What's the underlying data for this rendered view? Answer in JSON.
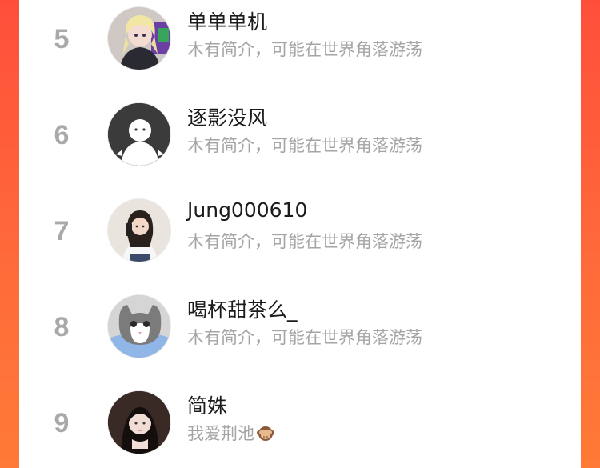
{
  "rankings": [
    {
      "rank": "5",
      "name": "单单单机",
      "bio": "木有简介，可能在世界角落游荡",
      "avatar": "anime-girl-avatar"
    },
    {
      "rank": "6",
      "name": "逐影没风",
      "bio": "木有简介，可能在世界角落游荡",
      "avatar": "default-ghost-avatar"
    },
    {
      "rank": "7",
      "name": "Jung000610",
      "bio": "木有简介，可能在世界角落游荡",
      "avatar": "girl-selfie-avatar"
    },
    {
      "rank": "8",
      "name": "喝杯甜茶么_",
      "bio": "木有简介，可能在世界角落游荡",
      "avatar": "cat-photo-avatar"
    },
    {
      "rank": "9",
      "name": "简姝",
      "bio": "我爱荆池",
      "avatar": "girl-portrait-avatar",
      "bio_emoji": "see-no-evil-monkey-icon"
    }
  ],
  "colors": {
    "background_gradient_start": "#ff4f3b",
    "background_gradient_end": "#ff7a36",
    "panel": "#ffffff",
    "rank_text": "#a9a9a9",
    "name_text": "#1b1b1b",
    "bio_text": "#a4a4a4"
  }
}
